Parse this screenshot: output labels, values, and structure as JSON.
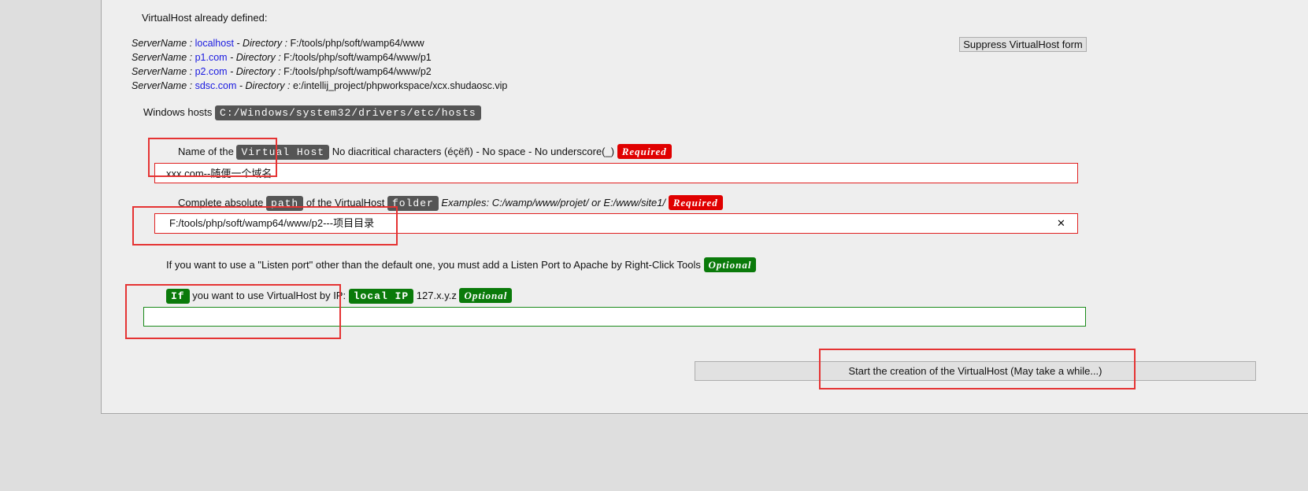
{
  "already_defined": "VirtualHost already defined:",
  "virtual_hosts": [
    {
      "sn_label": "ServerName :",
      "name": "localhost",
      "dir_sep": "- Directory :",
      "dir": "F:/tools/php/soft/wamp64/www"
    },
    {
      "sn_label": "ServerName :",
      "name": "p1.com",
      "dir_sep": "- Directory :",
      "dir": "F:/tools/php/soft/wamp64/www/p1"
    },
    {
      "sn_label": "ServerName :",
      "name": "p2.com",
      "dir_sep": "- Directory :",
      "dir": "F:/tools/php/soft/wamp64/www/p2"
    },
    {
      "sn_label": "ServerName :",
      "name": "sdsc.com",
      "dir_sep": "- Directory :",
      "dir": "e:/intellij_project/phpworkspace/xcx.shudaosc.vip"
    }
  ],
  "suppress_button": "Suppress VirtualHost form",
  "windows_hosts": {
    "label": "Windows hosts",
    "path": "C:/Windows/system32/drivers/etc/hosts"
  },
  "name_field": {
    "prefix": "Name of the",
    "tag": "Virtual Host",
    "hint": "No diacritical characters (éçëñ) - No space - No underscore(_)",
    "required": "Required",
    "value": "xxx.com--随便一个域名"
  },
  "path_field": {
    "prefix": "Complete absolute",
    "tag_path": "path",
    "middle": "of the VirtualHost",
    "tag_folder": "folder",
    "examples": "Examples: C:/wamp/www/projet/ or E:/www/site1/",
    "required": "Required",
    "value": "F:/tools/php/soft/wamp64/www/p2---项目目录",
    "clear_glyph": "✕"
  },
  "listen_port": {
    "text": "If you want to use a \"Listen port\" other than the default one, you must add a Listen Port to Apache by Right-Click Tools",
    "optional": "Optional"
  },
  "ip_field": {
    "tag_if": "If",
    "text": "you want to use VirtualHost by IP:",
    "tag_local_ip": "local IP",
    "pattern": "127.x.y.z",
    "optional": "Optional",
    "value": ""
  },
  "submit_button": "Start the creation of the VirtualHost (May take a while...)",
  "colors": {
    "required": "#e00000",
    "optional": "#0a7a0a",
    "annotation": "#e53333",
    "link": "#1a1ae0"
  }
}
